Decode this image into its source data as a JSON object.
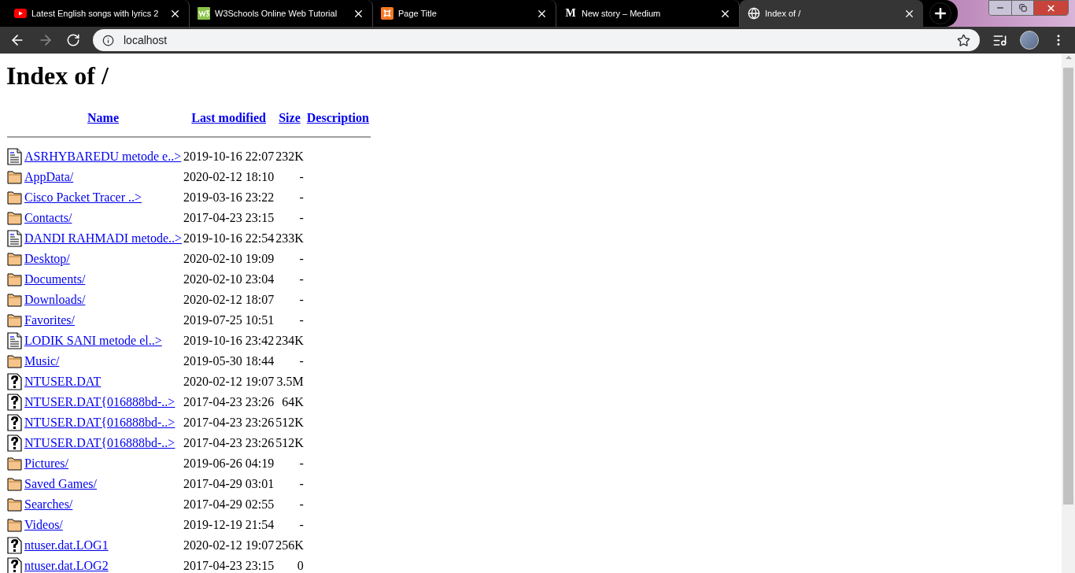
{
  "tabs": [
    {
      "title": "Latest English songs with lyrics 2",
      "kind": "video",
      "selected": false
    },
    {
      "title": "W3Schools Online Web Tutorial",
      "kind": "tutorial",
      "selected": false
    },
    {
      "title": "Page Title",
      "kind": "server",
      "selected": false
    },
    {
      "title": "New story – Medium",
      "kind": "letter",
      "icon_text": "M",
      "selected": false
    },
    {
      "title": "Index of /",
      "kind": "web",
      "selected": true
    }
  ],
  "toolbar": {
    "back_disabled": false,
    "forward_disabled": true,
    "address": "localhost"
  },
  "page": {
    "heading": "Index of /",
    "columns": [
      "Name",
      "Last modified",
      "Size",
      "Description"
    ],
    "rows": [
      {
        "kind": "text",
        "name": "ASRHYBAREDU metode e..>",
        "modified": "2019-10-16 22:07",
        "size": "232K"
      },
      {
        "kind": "folder",
        "name": "AppData/",
        "modified": "2020-02-12 18:10",
        "size": "-"
      },
      {
        "kind": "folder",
        "name": "Cisco Packet Tracer ..>",
        "modified": "2019-03-16 23:22",
        "size": "-"
      },
      {
        "kind": "folder",
        "name": "Contacts/",
        "modified": "2017-04-23 23:15",
        "size": "-"
      },
      {
        "kind": "text",
        "name": "DANDI RAHMADI metode..>",
        "modified": "2019-10-16 22:54",
        "size": "233K"
      },
      {
        "kind": "folder",
        "name": "Desktop/",
        "modified": "2020-02-10 19:09",
        "size": "-"
      },
      {
        "kind": "folder",
        "name": "Documents/",
        "modified": "2020-02-10 23:04",
        "size": "-"
      },
      {
        "kind": "folder",
        "name": "Downloads/",
        "modified": "2020-02-12 18:07",
        "size": "-"
      },
      {
        "kind": "folder",
        "name": "Favorites/",
        "modified": "2019-07-25 10:51",
        "size": "-"
      },
      {
        "kind": "text",
        "name": "LODIK SANI metode el..>",
        "modified": "2019-10-16 23:42",
        "size": "234K"
      },
      {
        "kind": "folder",
        "name": "Music/",
        "modified": "2019-05-30 18:44",
        "size": "-"
      },
      {
        "kind": "unknown",
        "name": "NTUSER.DAT",
        "modified": "2020-02-12 19:07",
        "size": "3.5M"
      },
      {
        "kind": "unknown",
        "name": "NTUSER.DAT{016888bd-..>",
        "modified": "2017-04-23 23:26",
        "size": "64K"
      },
      {
        "kind": "unknown",
        "name": "NTUSER.DAT{016888bd-..>",
        "modified": "2017-04-23 23:26",
        "size": "512K"
      },
      {
        "kind": "unknown",
        "name": "NTUSER.DAT{016888bd-..>",
        "modified": "2017-04-23 23:26",
        "size": "512K"
      },
      {
        "kind": "folder",
        "name": "Pictures/",
        "modified": "2019-06-26 04:19",
        "size": "-"
      },
      {
        "kind": "folder",
        "name": "Saved Games/",
        "modified": "2017-04-29 03:01",
        "size": "-"
      },
      {
        "kind": "folder",
        "name": "Searches/",
        "modified": "2017-04-29 02:55",
        "size": "-"
      },
      {
        "kind": "folder",
        "name": "Videos/",
        "modified": "2019-12-19 21:54",
        "size": "-"
      },
      {
        "kind": "unknown",
        "name": "ntuser.dat.LOG1",
        "modified": "2020-02-12 19:07",
        "size": "256K"
      },
      {
        "kind": "unknown",
        "name": "ntuser.dat.LOG2",
        "modified": "2017-04-23 23:15",
        "size": "0"
      }
    ]
  }
}
